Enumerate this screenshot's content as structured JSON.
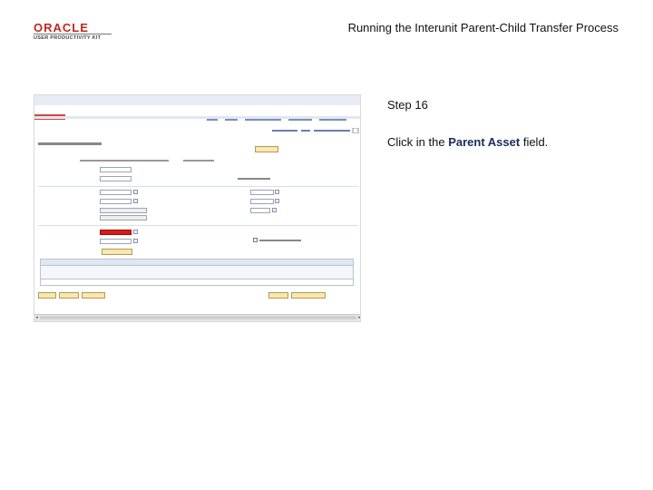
{
  "header": {
    "brand": "ORACLE",
    "sub": "USER PRODUCTIVITY KIT",
    "title": "Running the Interunit Parent-Child Transfer Process"
  },
  "step": {
    "label": "Step 16",
    "instruction_prefix": "Click in the",
    "instruction_bold": "Parent Asset",
    "instruction_suffix": "field."
  },
  "colors": {
    "brand_red": "#c4261d",
    "highlight": "#d51c1c",
    "button": "#f8e7b0"
  }
}
